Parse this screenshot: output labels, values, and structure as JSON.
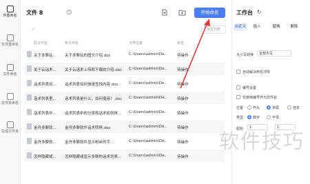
{
  "sidebar": {
    "items": [
      {
        "label": "件重命名",
        "active": true
      },
      {
        "label": "文件重命名",
        "active": false
      },
      {
        "label": "文件命名",
        "active": false
      },
      {
        "label": "文件夹命名",
        "active": false
      },
      {
        "label": "生成文件夹",
        "active": false
      }
    ]
  },
  "main": {
    "title": "文件 8",
    "help_icon": "?",
    "start_button": "开始命名",
    "clear_button": "清空列表",
    "columns": [
      "原文件名",
      "新文件名",
      "文件位置",
      "状态"
    ],
    "rows": [
      {
        "original": "关于多聊站...",
        "new_name": "关于多聊站的图文介绍.doc",
        "path": "C:\\Users\\admin\\De...",
        "status": "待操作"
      },
      {
        "original": "关于云话术...",
        "new_name": "关于云话术上传和下载的介绍.doc",
        "path": "C:\\Users\\admin\\De...",
        "status": "待操作"
      },
      {
        "original": "话术列表如...",
        "new_name": "话术列表如何快速查找内容.doc",
        "path": "C:\\Users\\admin\\De...",
        "status": "待操作"
      },
      {
        "original": "话术列表里...",
        "new_name": "话术列表是什么，如何使用？.doc",
        "path": "C:\\Users\\admin\\De...",
        "status": "待操作"
      },
      {
        "original": "话术列表中...",
        "new_name": "话术列表中的分类和话术如何排...",
        "path": "C:\\Users\\admin\\De...",
        "status": "待操作"
      },
      {
        "original": "金舟多聊软...",
        "new_name": "金舟多聊软件话术转移.doc",
        "path": "C:\\Users\\admin\\De...",
        "status": "待操作"
      },
      {
        "original": "金舟多聊软...",
        "new_name": "金舟多聊软件显示粉丝的字...",
        "path": "C:\\Users\\admin\\De...",
        "status": "待操作"
      },
      {
        "original": "怎样隐藏或...",
        "new_name": "怎样隐藏或显示多聊的话术列表...",
        "path": "C:\\Users\\admin\\De...",
        "status": "待操作"
      }
    ]
  },
  "panel": {
    "title": "工作台",
    "tabs": [
      "自定义",
      "插入",
      "替换",
      "删除"
    ],
    "case_label": "大小写转换",
    "case_value": "全部大写",
    "auto_dedupe": "自动解决命名冲突",
    "numbering": "编号设置",
    "only_use_numbering": "仅使用编号作为文件名",
    "position_label": "位置",
    "position_options": [
      "开头",
      "末尾",
      "自定"
    ],
    "type_label": "类型",
    "type_options": [
      "数字",
      "字母"
    ],
    "start_label": "起始",
    "start_value": "1",
    "step_value": "1"
  },
  "watermark": "软件技巧",
  "colors": {
    "accent": "#4a7dff",
    "arrow": "#e53935"
  }
}
